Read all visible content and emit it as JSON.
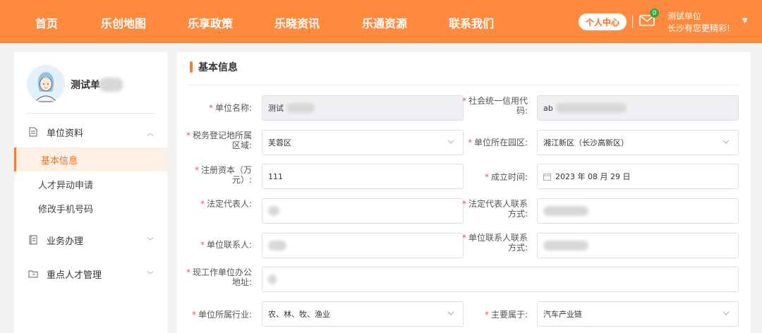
{
  "nav": {
    "items": [
      "首页",
      "乐创地图",
      "乐享政策",
      "乐晓资讯",
      "乐通资源",
      "联系我们"
    ],
    "user_center": "个人中心",
    "mail_count": "0",
    "user_name": "测试单位",
    "slogan": "长沙有您更精彩!",
    "accent": "#ff8a3d"
  },
  "sidebar": {
    "profile_name": "测试单",
    "groups": [
      {
        "label": "单位资料",
        "icon": "document-icon",
        "expanded": true,
        "children": [
          "基本信息",
          "人才异动申请",
          "修改手机号码"
        ],
        "active_child": "基本信息"
      },
      {
        "label": "业务办理",
        "icon": "book-icon",
        "expanded": false
      },
      {
        "label": "重点人才管理",
        "icon": "folder-icon",
        "expanded": false
      }
    ]
  },
  "main": {
    "section_title": "基本信息",
    "fields": {
      "unit_name": {
        "label": "单位名称:",
        "value": "测试"
      },
      "credit_code": {
        "label_1": "社会统一信用代",
        "label_2": "码:",
        "value": "ab"
      },
      "tax_area": {
        "label_1": "税务登记地所属",
        "label_2": "区域:",
        "value": "芙蓉区"
      },
      "park": {
        "label": "单位所在园区:",
        "value": "湘江新区（长沙高新区）"
      },
      "capital": {
        "label_1": "注册资本（万",
        "label_2": "元）:",
        "value": "111"
      },
      "founded": {
        "label": "成立时间:",
        "value": "2023 年 08 月 29 日"
      },
      "legal_rep": {
        "label": "法定代表人:",
        "value": ""
      },
      "legal_contact": {
        "label_1": "法定代表人联系",
        "label_2": "方式:",
        "value": ""
      },
      "contact_person": {
        "label": "单位联系人:",
        "value": ""
      },
      "contact_phone": {
        "label_1": "单位联系人联系",
        "label_2": "方式:",
        "value": ""
      },
      "address": {
        "label_1": "现工作单位办公",
        "label_2": "地址:",
        "value": ""
      },
      "industry": {
        "label": "单位所属行业:",
        "value": "农、林、牧、渔业"
      },
      "main_chain": {
        "label": "主要属于:",
        "value": "汽车产业链"
      }
    }
  }
}
